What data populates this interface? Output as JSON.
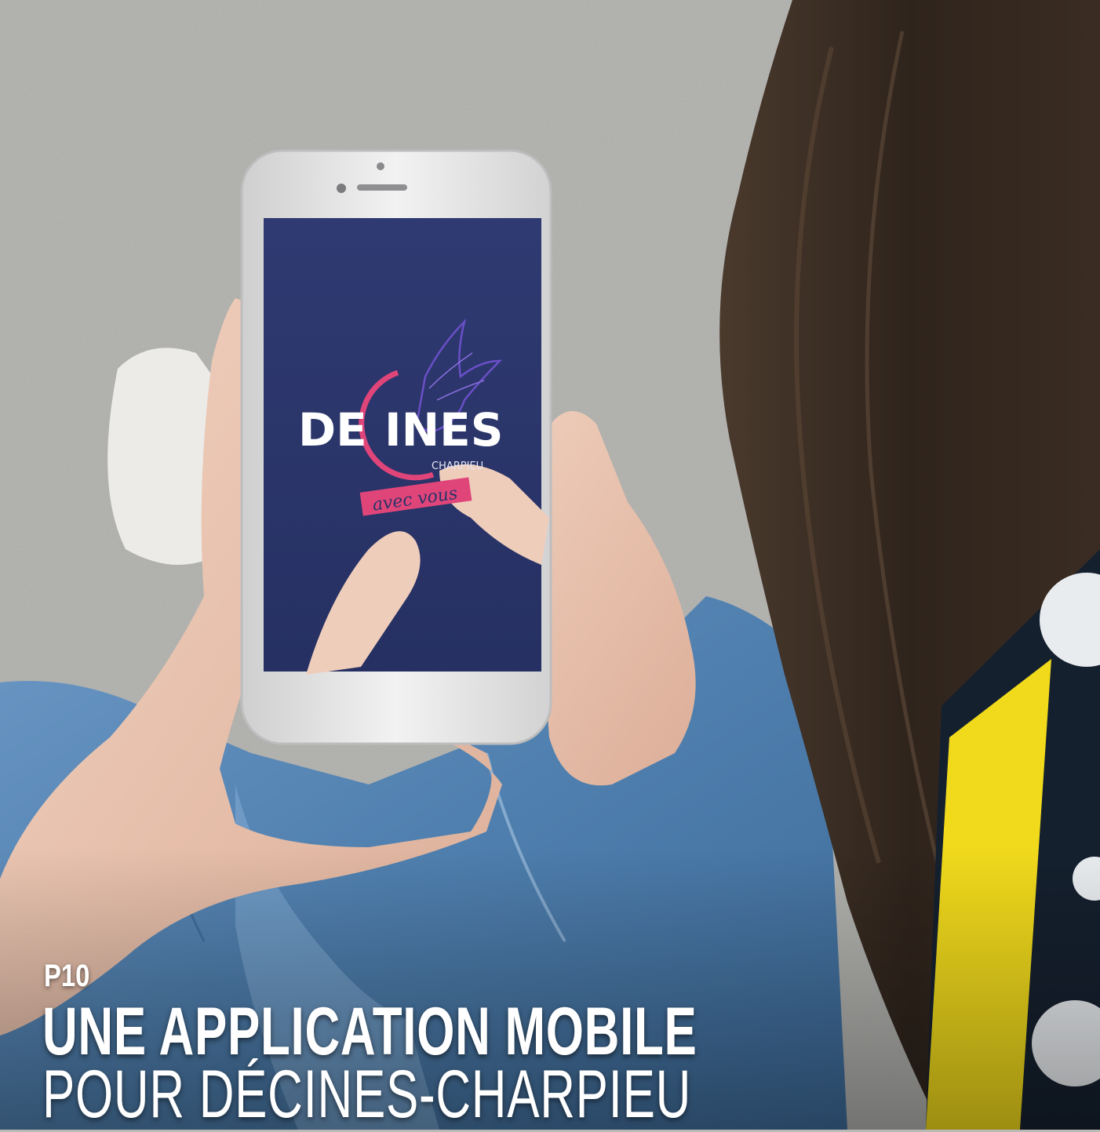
{
  "caption": {
    "page_label": "P10",
    "headline": "UNE APPLICATION MOBILE",
    "subheadline": "POUR DÉCINES-CHARPIEU"
  },
  "phone_screen": {
    "logo_word": "DE INES",
    "logo_small": "CHARPIEU",
    "logo_tagline": "avec vous"
  },
  "colors": {
    "screen": "#2a3468",
    "logo_pink": "#e0457a",
    "logo_violet": "#6a4fc7",
    "denim": "#5a88b8",
    "hair": "#3b2e24",
    "shirt_yellow": "#f1da1c"
  }
}
